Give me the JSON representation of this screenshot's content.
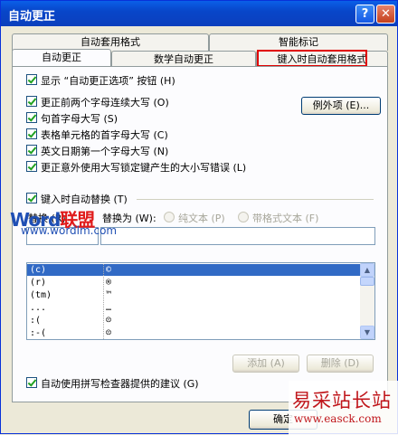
{
  "window": {
    "title": "自动更正",
    "help_glyph": "?",
    "close_glyph": "✕"
  },
  "tabs": [
    {
      "label": "自动套用格式"
    },
    {
      "label": "智能标记"
    },
    {
      "label": "自动更正"
    },
    {
      "label": "数学自动更正"
    },
    {
      "label": "键入时自动套用格式"
    }
  ],
  "options": {
    "show_button": "显示 “自动更正选项” 按钮 (H)",
    "two_initial_caps": "更正前两个字母连续大写 (O)",
    "capitalize_sentence": "句首字母大写 (S)",
    "capitalize_table_cells": "表格单元格的首字母大写 (C)",
    "capitalize_day_names": "英文日期第一个字母大写 (N)",
    "caps_lock": "更正意外使用大写锁定键产生的大小写错误 (L)",
    "exceptions_button": "例外项 (E)..."
  },
  "replace": {
    "checkbox_label": "键入时自动替换 (T)",
    "replace_label": "替换 (R)",
    "with_label": "替换为 (W):",
    "plain_text": "纯文本 (P)",
    "formatted_text": "带格式文本 (F)",
    "replace_value": "",
    "with_value": ""
  },
  "entries": [
    {
      "from": "(c)",
      "to": "©"
    },
    {
      "from": "(r)",
      "to": "®"
    },
    {
      "from": "(tm)",
      "to": "™"
    },
    {
      "from": "...",
      "to": "…"
    },
    {
      "from": ":(",
      "to": "☹"
    },
    {
      "from": ":-(",
      "to": "☹"
    }
  ],
  "buttons": {
    "add": "添加 (A)",
    "delete": "删除 (D)",
    "ok": "确定"
  },
  "spellcheck_label": "自动使用拼写检查器提供的建议 (G)",
  "watermarks": {
    "wordlm_a": "Word",
    "wordlm_b": "联盟",
    "wordlm_url": "www.wordlm.com",
    "easck_cn": "易采站长站",
    "easck_url": "www.easck.com"
  }
}
